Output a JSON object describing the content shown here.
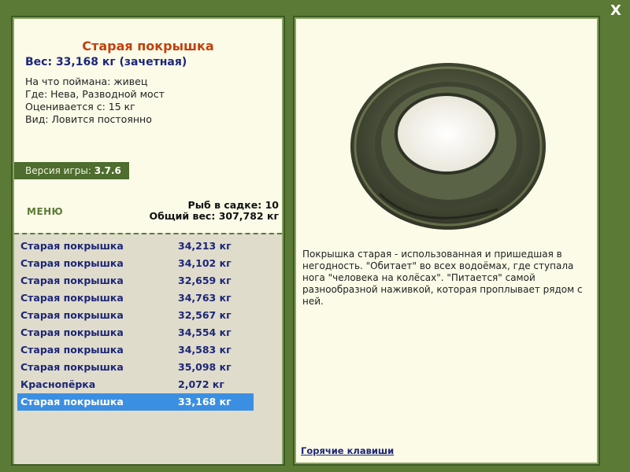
{
  "close_label": "X",
  "fish": {
    "title": "Старая покрышка",
    "weight": "Вес: 33,168 кг (зачетная)",
    "caught_on": "На что поймана: живец",
    "location": "Где: Нева, Разводной мост",
    "rated_from": "Оценивается с: 15 кг",
    "kind": "Вид: Ловится постоянно",
    "description": "Покрышка старая - использованная и пришедшая в негодность. \"Обитает\" во всех водоёмах, где ступала нога \"человека на колёсах\". \"Питается\" самой разнообразной наживкой, которая проплывает рядом с ней."
  },
  "version": {
    "label": "Версия игры: ",
    "number": "3.7.6"
  },
  "menu_label": "МЕНЮ",
  "stats": {
    "fish_in_keepnet": "Рыб в садке: 10",
    "total_weight": "Общий вес: 307,782 кг"
  },
  "catch_list": [
    {
      "name": "Старая покрышка",
      "weight": "34,213 кг"
    },
    {
      "name": "Старая покрышка",
      "weight": "34,102 кг"
    },
    {
      "name": "Старая покрышка",
      "weight": "32,659 кг"
    },
    {
      "name": "Старая покрышка",
      "weight": "34,763 кг"
    },
    {
      "name": "Старая покрышка",
      "weight": "32,567 кг"
    },
    {
      "name": "Старая покрышка",
      "weight": "34,554 кг"
    },
    {
      "name": "Старая покрышка",
      "weight": "34,583 кг"
    },
    {
      "name": "Старая покрышка",
      "weight": "35,098 кг"
    },
    {
      "name": "Краснопёрка",
      "weight": "2,072 кг"
    },
    {
      "name": "Старая покрышка",
      "weight": "33,168 кг"
    }
  ],
  "selected_index": 9,
  "hotkeys_label": "Горячие клавиши",
  "colors": {
    "frame": "#5b7a36",
    "panel": "#fbfbe8",
    "title": "#c2410c",
    "list_text": "#1d2677",
    "selection": "#3b8fe2"
  }
}
